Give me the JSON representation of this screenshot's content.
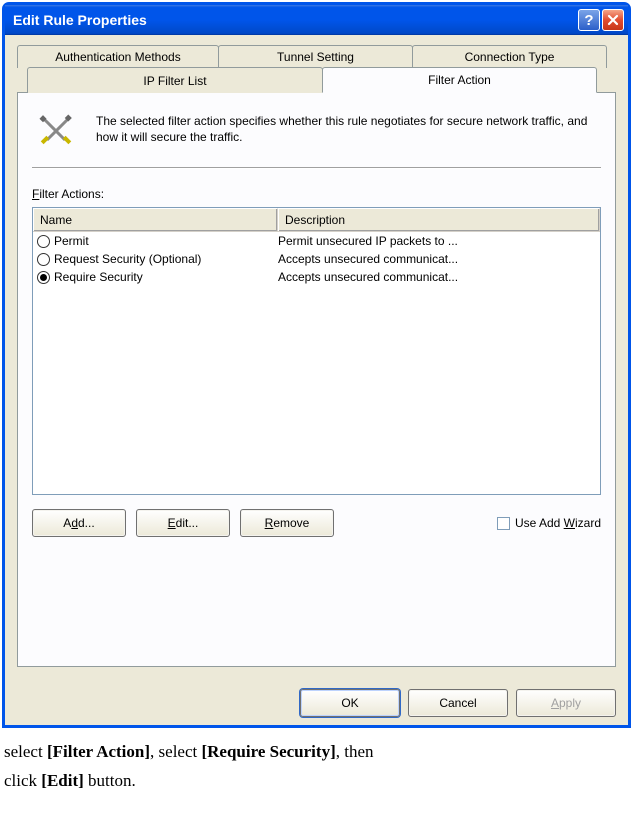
{
  "window": {
    "title": "Edit Rule Properties"
  },
  "tabs": {
    "row1": [
      "Authentication Methods",
      "Tunnel Setting",
      "Connection Type"
    ],
    "row2": [
      "IP Filter List",
      "Filter Action"
    ]
  },
  "panel": {
    "info_text": "The selected filter action specifies whether this rule negotiates for secure network traffic, and how it will secure the traffic.",
    "section_label_prefix": "F",
    "section_label_rest": "ilter Actions:",
    "columns": {
      "name": "Name",
      "description": "Description"
    },
    "rows": [
      {
        "name": "Permit",
        "desc": "Permit unsecured IP packets to ...",
        "selected": false
      },
      {
        "name": "Request Security (Optional)",
        "desc": "Accepts unsecured communicat...",
        "selected": false
      },
      {
        "name": "Require Security",
        "desc": "Accepts unsecured communicat...",
        "selected": true
      }
    ],
    "buttons": {
      "add_prefix": "A",
      "add_u": "d",
      "add_rest": "d...",
      "edit_u": "E",
      "edit_rest": "dit...",
      "remove_u": "R",
      "remove_rest": "emove",
      "wizard_prefix": "Use Add ",
      "wizard_u": "W",
      "wizard_rest": "izard"
    }
  },
  "footer": {
    "ok": "OK",
    "cancel": "Cancel",
    "apply_u": "A",
    "apply_rest": "pply"
  },
  "caption": {
    "p1a": "select ",
    "p1b": "[Filter Action]",
    "p1c": ", select ",
    "p1d": "[Require Security]",
    "p1e": ", then",
    "p2a": "click ",
    "p2b": "[Edit]",
    "p2c": " button."
  }
}
